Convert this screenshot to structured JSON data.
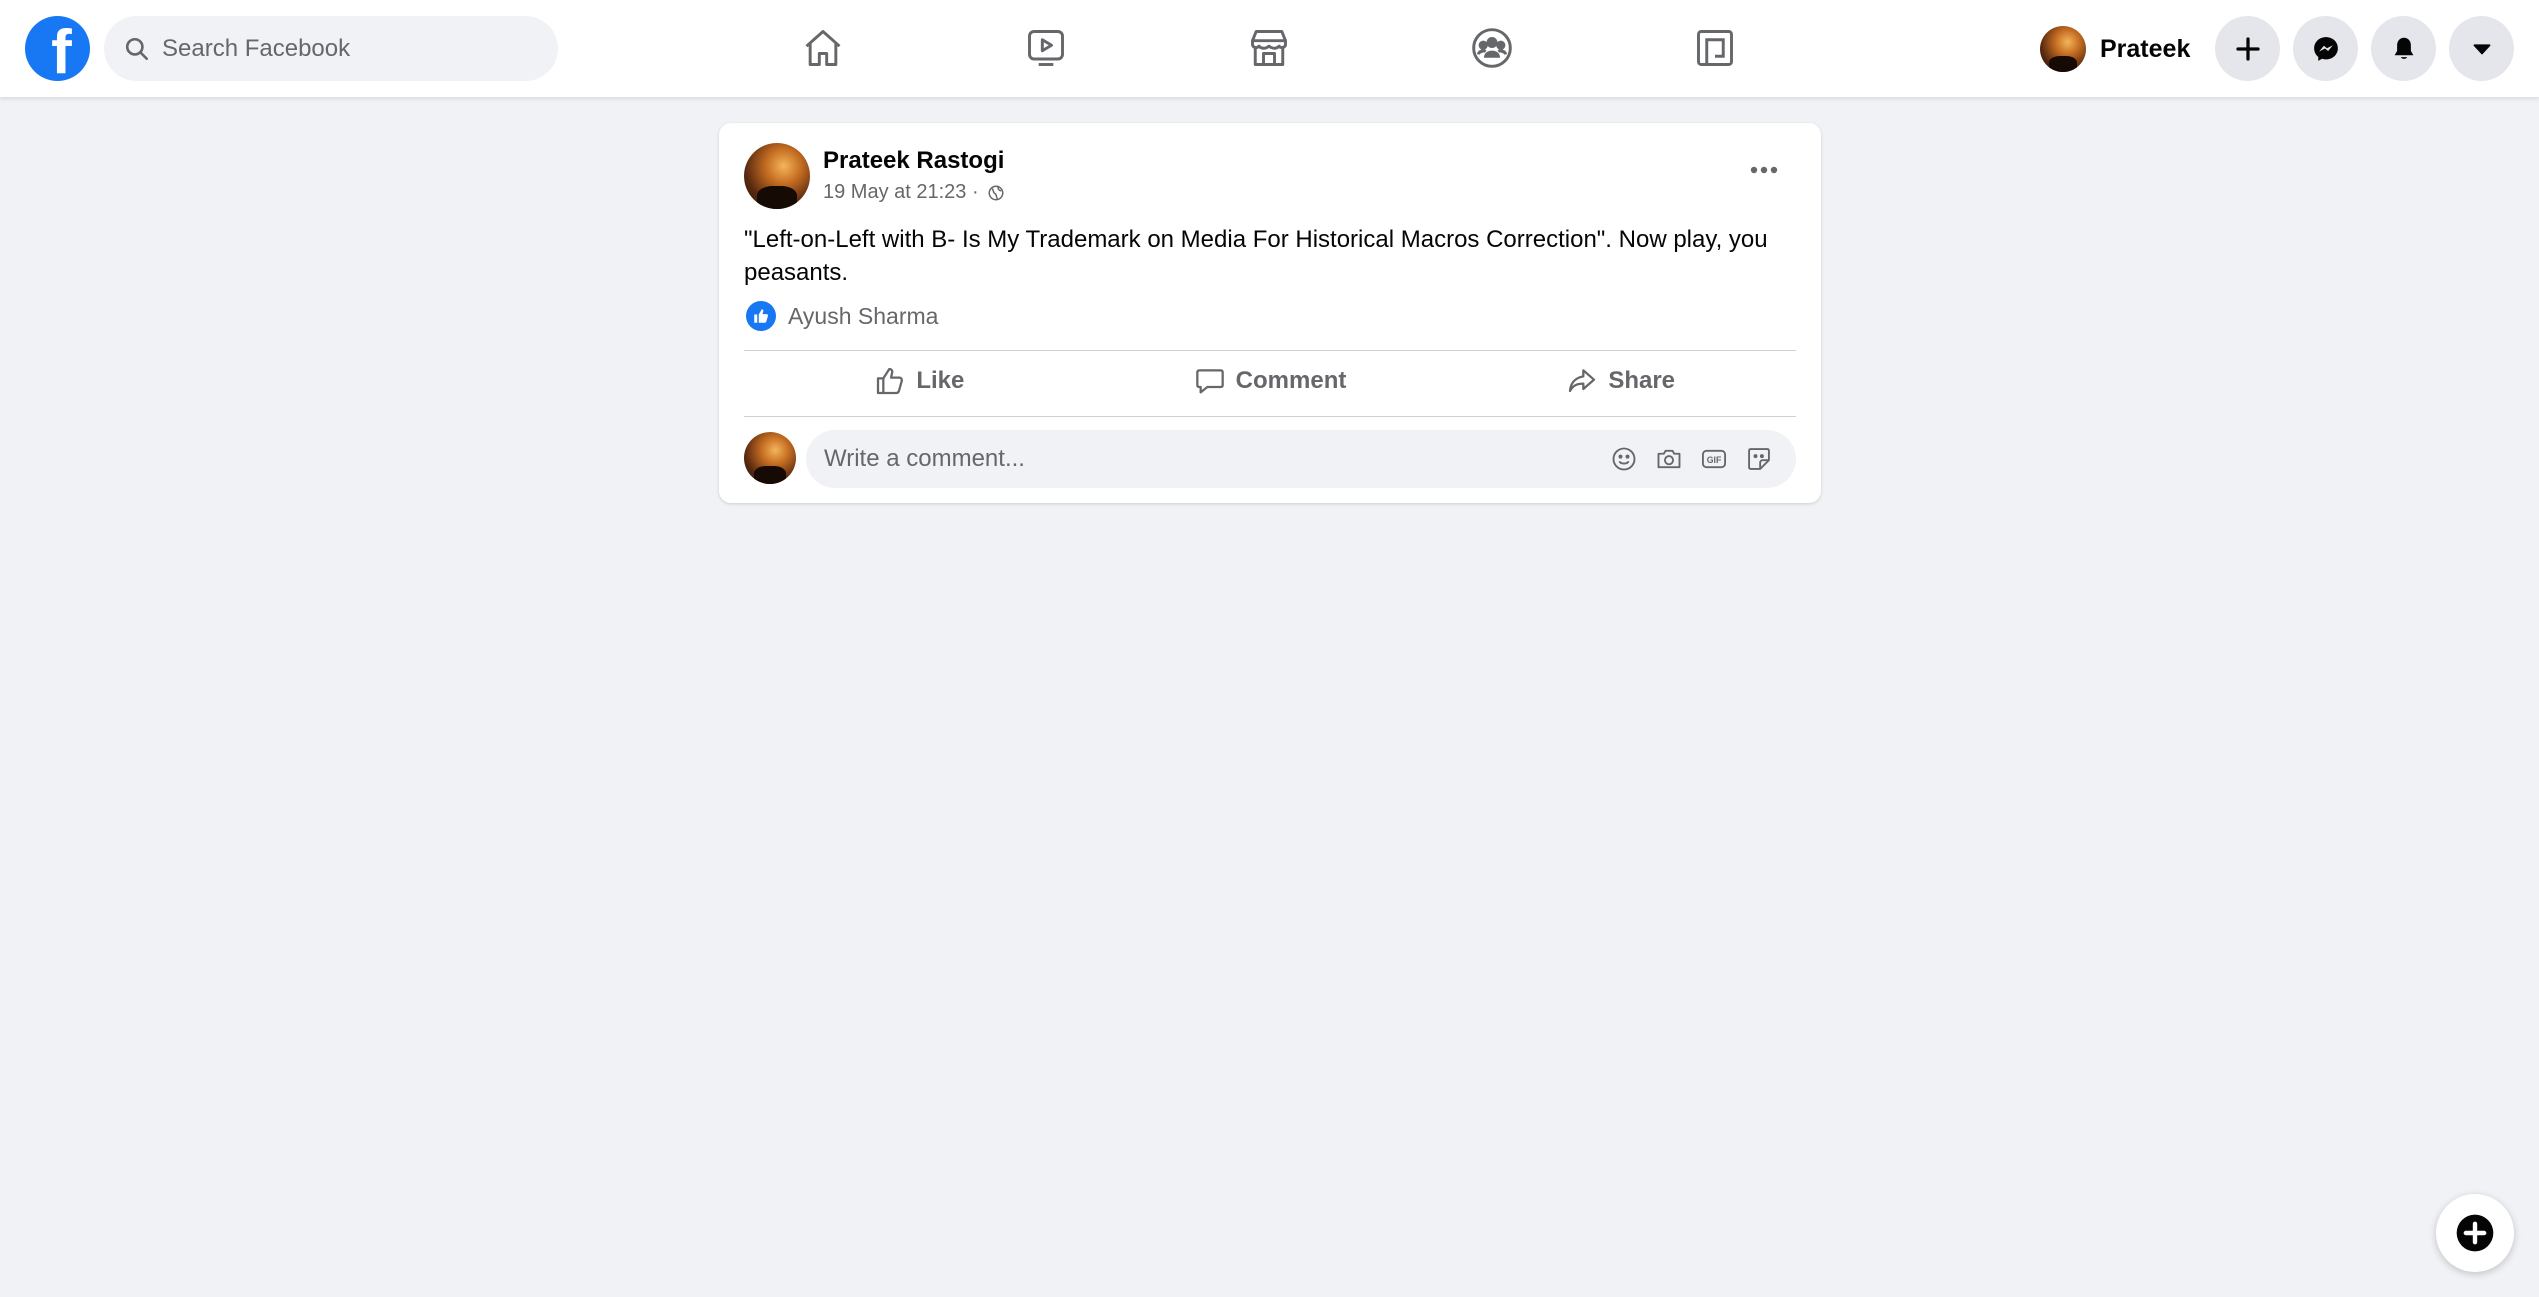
{
  "topbar": {
    "logo_letter": "f",
    "search_placeholder": "Search Facebook",
    "nav_icons": [
      "home-icon",
      "watch-icon",
      "marketplace-icon",
      "groups-icon",
      "gaming-icon"
    ],
    "profile_name": "Prateek",
    "buttons": [
      "create-icon",
      "messenger-icon",
      "notifications-icon",
      "account-menu-icon"
    ]
  },
  "post": {
    "author": "Prateek Rastogi",
    "timestamp": "19 May at 21:23 ·",
    "text": "\"Left-on-Left with B- Is My Trademark on Media For Historical Macros Correction\". Now play, you peasants.",
    "reactions": {
      "name": "Ayush Sharma"
    },
    "actions": {
      "like": "Like",
      "comment": "Comment",
      "share": "Share"
    },
    "comment_placeholder": "Write a comment..."
  },
  "colors": {
    "brand": "#1877f2",
    "background": "#f0f2f5",
    "muted_text": "#65676b"
  }
}
